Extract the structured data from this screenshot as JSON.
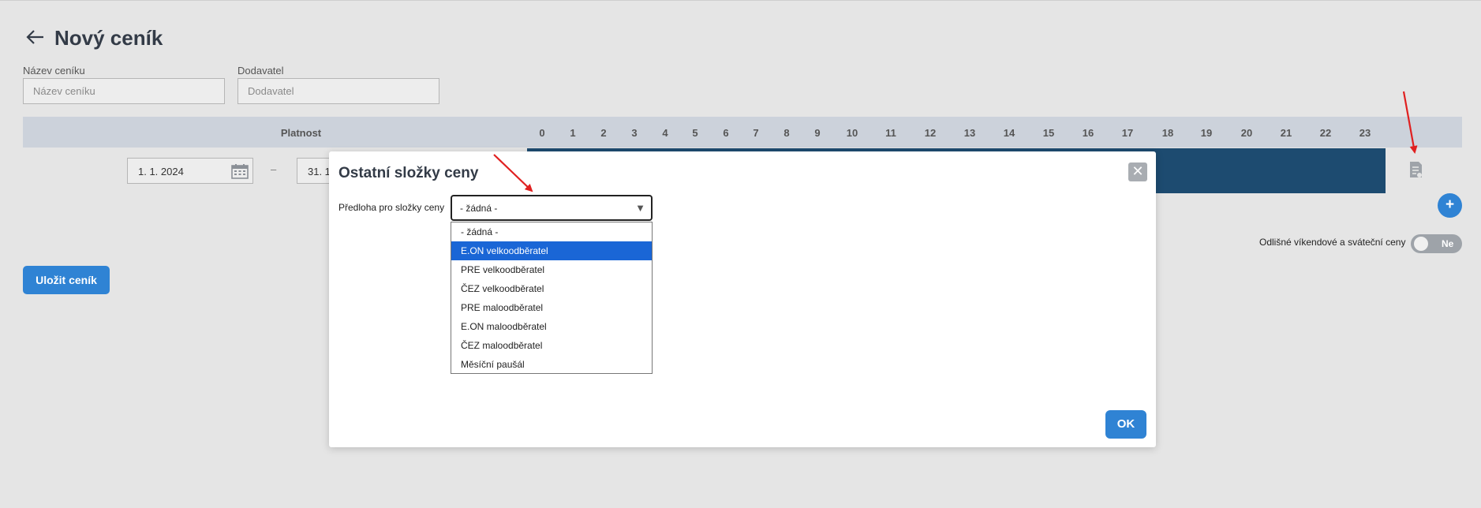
{
  "header": {
    "title": "Nový ceník"
  },
  "form": {
    "name_label": "Název ceníku",
    "name_placeholder": "Název ceníku",
    "supplier_label": "Dodavatel",
    "supplier_placeholder": "Dodavatel"
  },
  "table": {
    "validity_header": "Platnost",
    "hours": [
      "0",
      "1",
      "2",
      "3",
      "4",
      "5",
      "6",
      "7",
      "8",
      "9",
      "10",
      "11",
      "12",
      "13",
      "14",
      "15",
      "16",
      "17",
      "18",
      "19",
      "20",
      "21",
      "22",
      "23"
    ]
  },
  "row": {
    "date_from": "1. 1. 2024",
    "date_to": "31. 1",
    "separator": "–"
  },
  "add_button_label": "+",
  "weekend": {
    "label": "Odlišné víkendové a sváteční ceny",
    "toggle_text": "Ne"
  },
  "save_button_label": "Uložit ceník",
  "modal": {
    "title": "Ostatní složky ceny",
    "close_label": "✕",
    "field_label": "Předloha pro složky ceny",
    "selected_value": "- žádná -",
    "options": [
      "- žádná -",
      "E.ON velkoodběratel",
      "PRE velkoodběratel",
      "ČEZ velkoodběratel",
      "PRE maloodběratel",
      "E.ON maloodběratel",
      "ČEZ maloodběratel",
      "Měsíční paušál"
    ],
    "highlighted_option": "E.ON velkoodběratel",
    "ok_label": "OK"
  },
  "colors": {
    "accent": "#2f83d4",
    "bar": "#1d4b70",
    "table_header": "#ccd2db",
    "annotation": "#e02020"
  },
  "icons": [
    "back-arrow-icon",
    "calendar-icon",
    "document-icon",
    "plus-icon",
    "close-icon",
    "dropdown-arrow-icon"
  ]
}
